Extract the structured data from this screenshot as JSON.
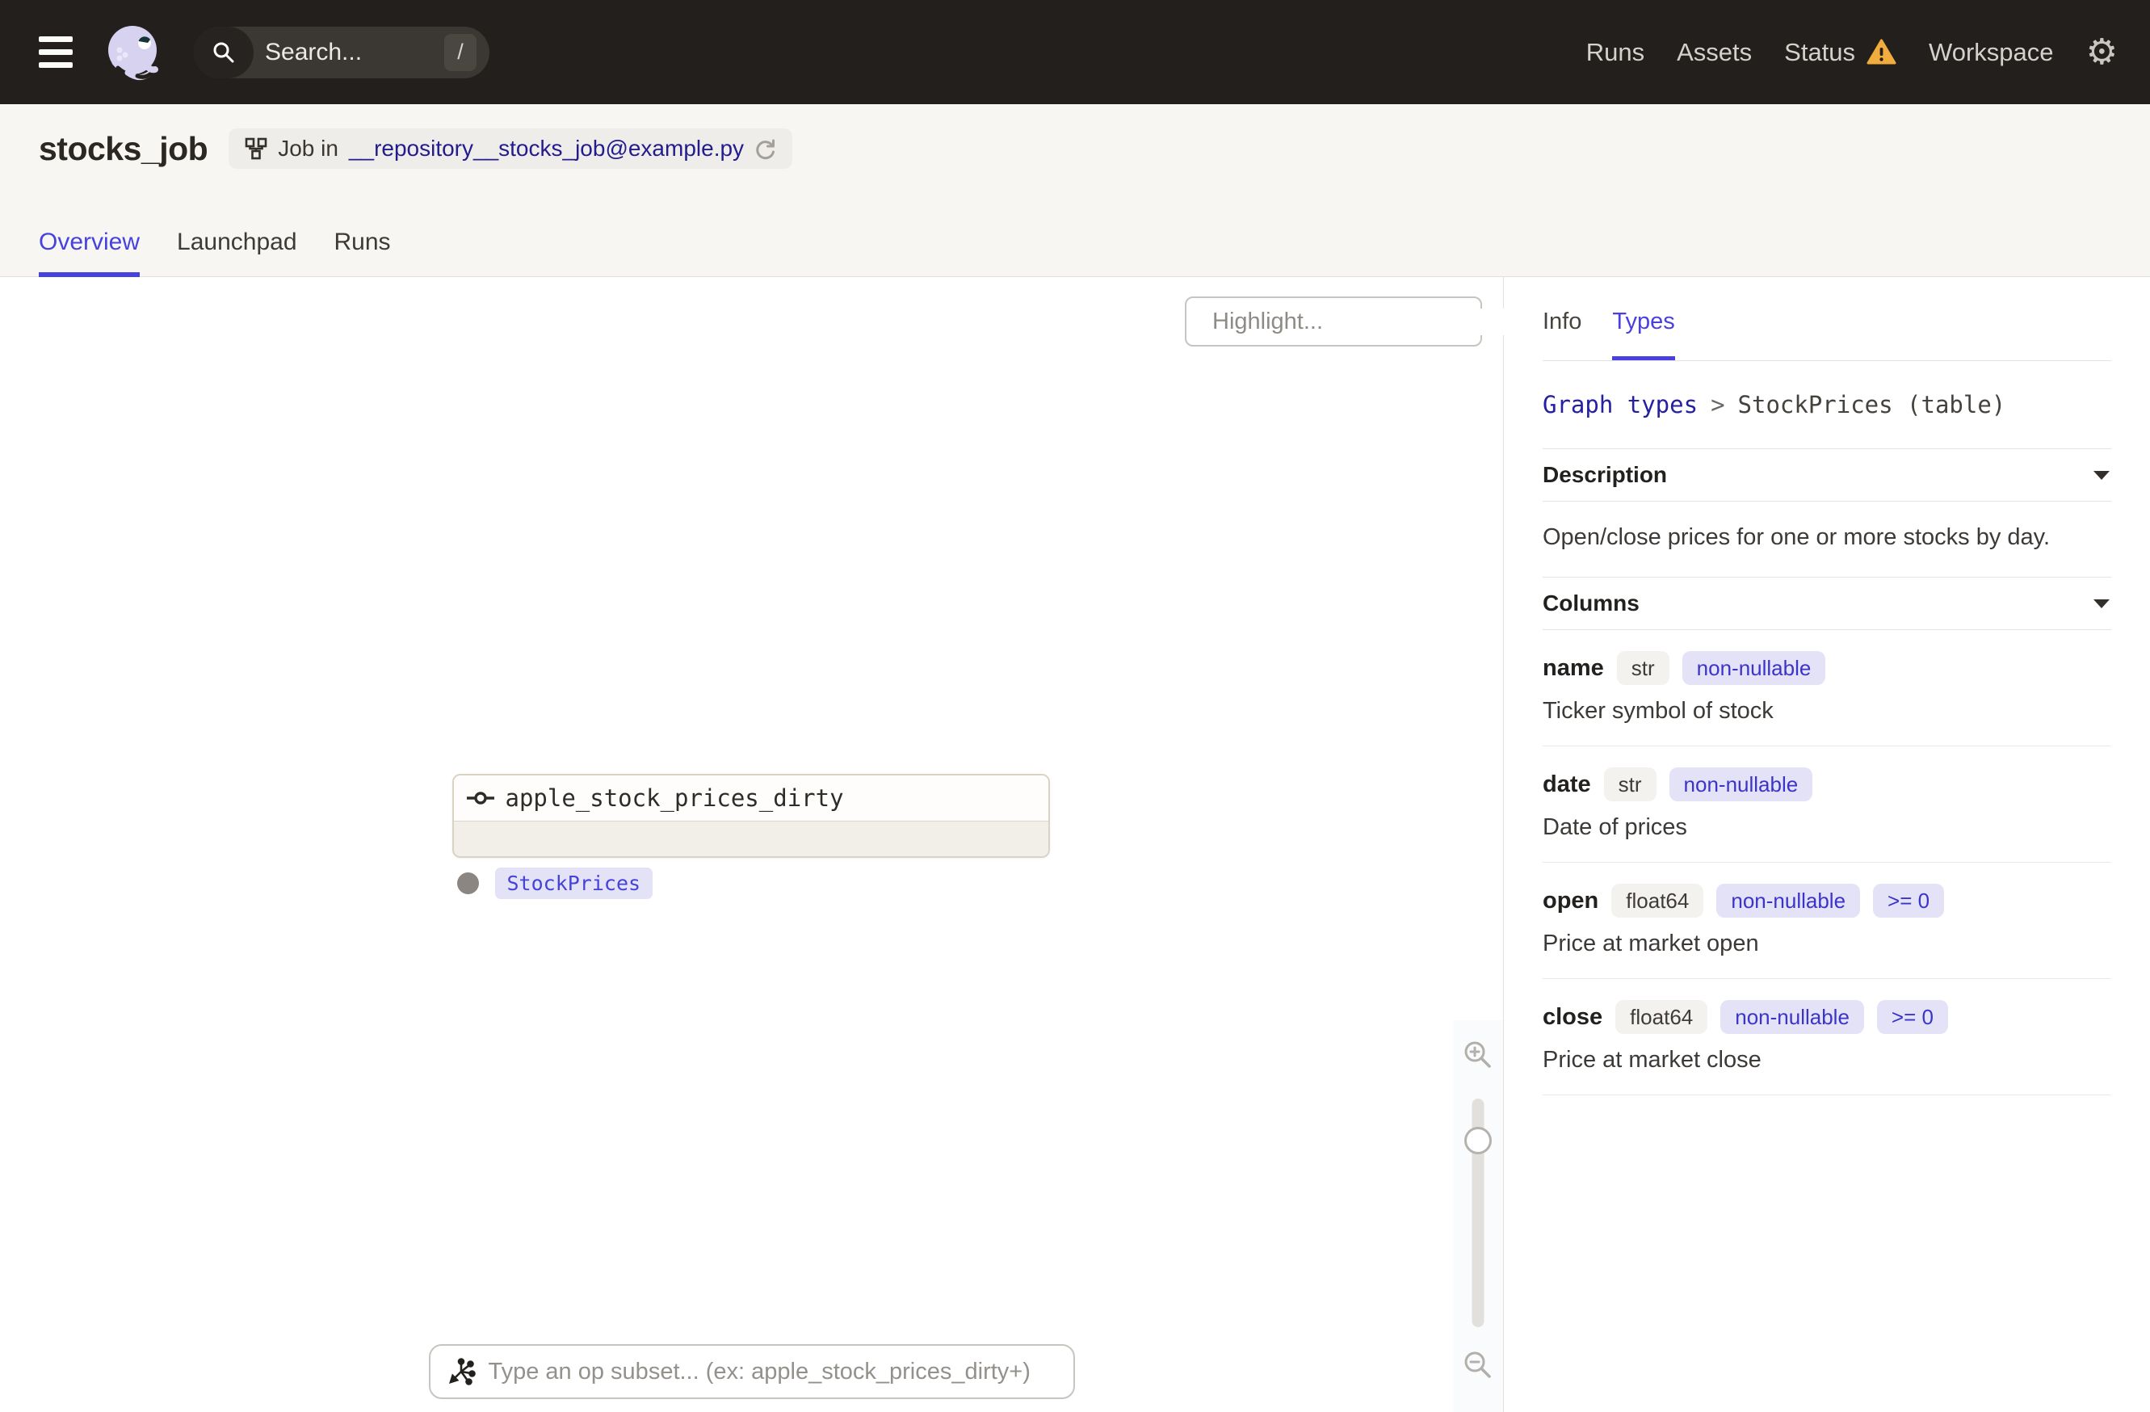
{
  "nav": {
    "search_placeholder": "Search...",
    "search_shortcut": "/",
    "links": [
      {
        "label": "Runs"
      },
      {
        "label": "Assets"
      },
      {
        "label": "Status",
        "has_warning": true
      },
      {
        "label": "Workspace"
      }
    ]
  },
  "header": {
    "title": "stocks_job",
    "badge": {
      "prefix": "Job in",
      "link": "__repository__stocks_job@example.py"
    },
    "tabs": [
      {
        "label": "Overview",
        "active": true
      },
      {
        "label": "Launchpad",
        "active": false
      },
      {
        "label": "Runs",
        "active": false
      }
    ]
  },
  "graph": {
    "highlight_placeholder": "Highlight...",
    "node": {
      "title": "apple_stock_prices_dirty",
      "output_type": "StockPrices"
    },
    "op_subset_placeholder": "Type an op subset... (ex: apple_stock_prices_dirty+)"
  },
  "panel": {
    "tabs": [
      {
        "label": "Info",
        "active": false
      },
      {
        "label": "Types",
        "active": true
      }
    ],
    "breadcrumb": {
      "link": "Graph types",
      "separator": ">",
      "current": "StockPrices (table)"
    },
    "description": {
      "title": "Description",
      "body": "Open/close prices for one or more stocks by day."
    },
    "columns_title": "Columns",
    "columns": [
      {
        "name": "name",
        "type": "str",
        "tags": [
          "non-nullable"
        ],
        "description": "Ticker symbol of stock"
      },
      {
        "name": "date",
        "type": "str",
        "tags": [
          "non-nullable"
        ],
        "description": "Date of prices"
      },
      {
        "name": "open",
        "type": "float64",
        "tags": [
          "non-nullable",
          ">= 0"
        ],
        "description": "Price at market open"
      },
      {
        "name": "close",
        "type": "float64",
        "tags": [
          "non-nullable",
          ">= 0"
        ],
        "description": "Price at market close"
      }
    ]
  },
  "colors": {
    "accent": "#4642df",
    "warning": "#f0ac3c",
    "link_navy": "#221c8c",
    "tag_bg": "#e4e2f7",
    "tag_text": "#3b34c9",
    "nav_bg": "#231f1c"
  }
}
